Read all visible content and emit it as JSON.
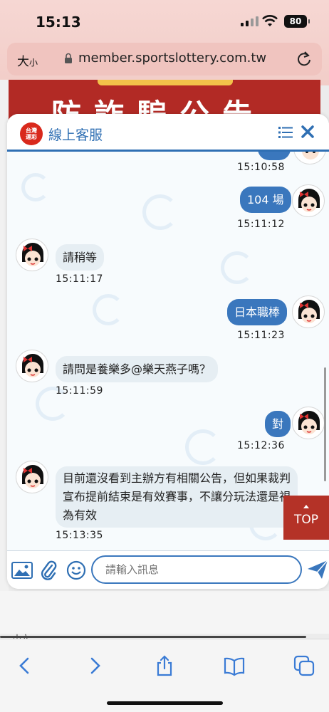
{
  "status_bar": {
    "time": "15:13",
    "battery": "80"
  },
  "browser": {
    "text_size_label": "大",
    "text_size_small": "小",
    "url": "member.sportslottery.com.tw"
  },
  "page": {
    "banner_text": "防詐騙公告",
    "language": "中文"
  },
  "chat": {
    "logo_text_1": "台灣",
    "logo_text_2": "運彩",
    "title": "線上客服",
    "messages": [
      {
        "side": "out",
        "text": "",
        "time": "15:10:58"
      },
      {
        "side": "out",
        "text": "104 場",
        "time": "15:11:12"
      },
      {
        "side": "in",
        "text": "請稍等",
        "time": "15:11:17"
      },
      {
        "side": "out",
        "text": "日本職棒",
        "time": "15:11:23"
      },
      {
        "side": "in",
        "text": "請問是養樂多@樂天燕子嗎？",
        "time": "15:11:59"
      },
      {
        "side": "out",
        "text": "對",
        "time": "15:12:36"
      },
      {
        "side": "in",
        "text": "目前還沒看到主辦方有相關公告，但如果裁判宣布提前結束是有效賽事，不讓分玩法還是視為有效",
        "time": "15:13:35"
      }
    ],
    "input_placeholder": "請輸入訊息",
    "top_button": "TOP"
  },
  "colors": {
    "accent": "#3a77bd",
    "brand_red": "#b22a25",
    "incoming_bubble": "#e6eef3"
  },
  "icons": [
    "signal-icon",
    "wifi-icon",
    "battery-icon",
    "lock-icon",
    "reload-icon",
    "menu-icon",
    "close-icon",
    "image-icon",
    "paperclip-icon",
    "smile-icon",
    "send-icon",
    "back-icon",
    "forward-icon",
    "share-icon",
    "bookmarks-icon",
    "tabs-icon"
  ]
}
